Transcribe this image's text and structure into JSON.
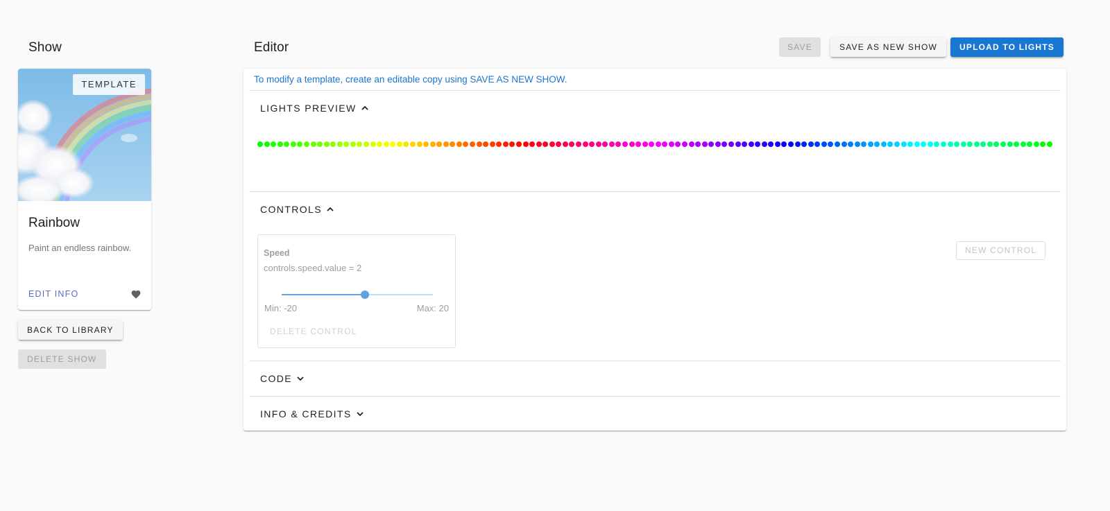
{
  "left": {
    "title": "Show",
    "card": {
      "chip": "TEMPLATE",
      "name": "Rainbow",
      "description": "Paint an endless rainbow.",
      "edit_label": "EDIT INFO",
      "favorite_icon": "heart-icon"
    },
    "back_label": "BACK TO LIBRARY",
    "delete_label": "DELETE SHOW"
  },
  "editor": {
    "title": "Editor",
    "toolbar": {
      "save_label": "SAVE",
      "save_new_label": "SAVE AS NEW SHOW",
      "upload_label": "UPLOAD TO LIGHTS"
    },
    "notice": "To modify a template, create an editable copy using SAVE AS NEW SHOW.",
    "sections": {
      "preview": {
        "label": "LIGHTS PREVIEW",
        "expanded": true
      },
      "controls": {
        "label": "CONTROLS",
        "expanded": true
      },
      "code": {
        "label": "CODE",
        "expanded": false
      },
      "credits": {
        "label": "INFO & CREDITS",
        "expanded": false
      }
    },
    "preview": {
      "led_count": 120
    },
    "controls": {
      "items": [
        {
          "name": "Speed",
          "expression": "controls.speed.value = 2",
          "min_label": "Min: -20",
          "max_label": "Max: 20",
          "min": -20,
          "max": 20,
          "value": 2,
          "delete_label": "DELETE CONTROL"
        }
      ],
      "new_label": "NEW CONTROL"
    }
  },
  "colors": {
    "primary": "#1976d2",
    "link": "#5c6bc0",
    "background": "#fafafa"
  }
}
